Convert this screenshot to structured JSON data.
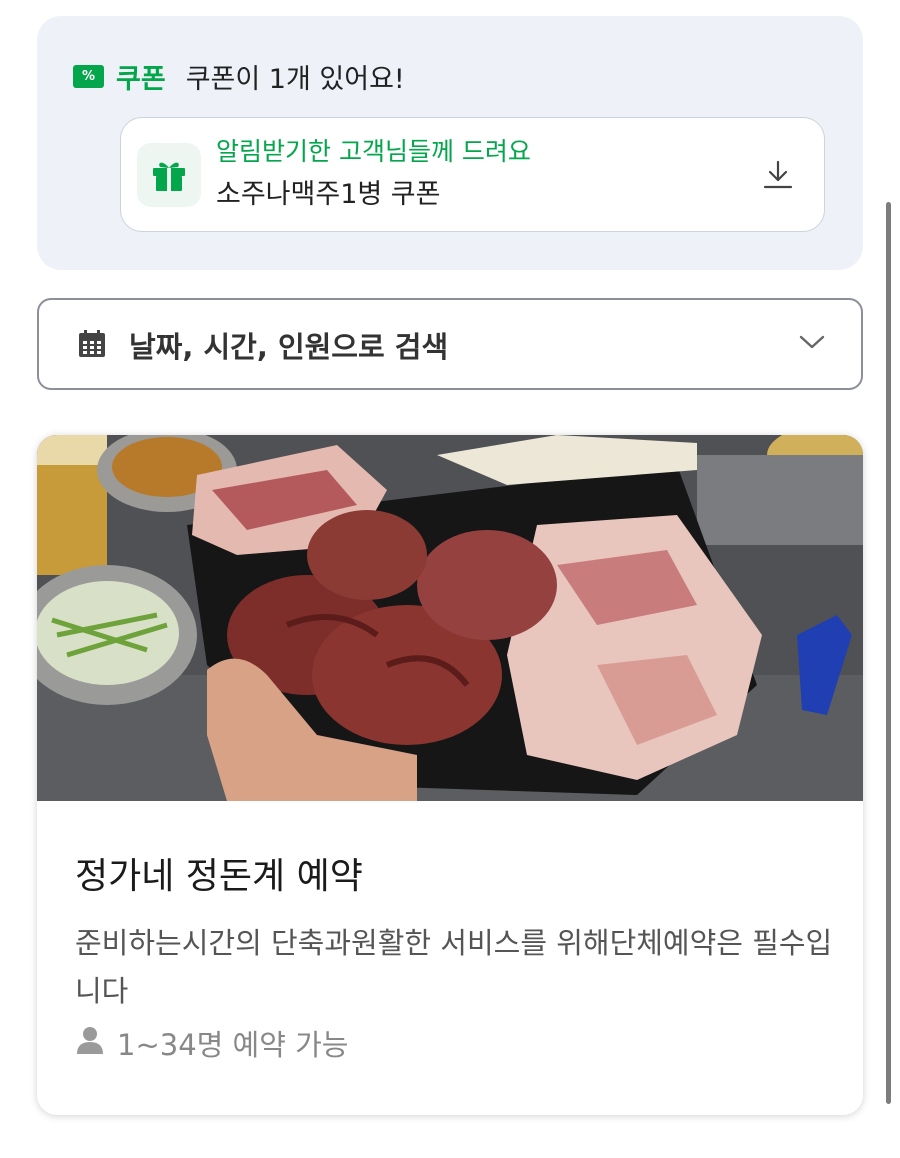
{
  "coupon": {
    "section_label": "쿠폰",
    "count_text": "쿠폰이 1개 있어요!",
    "tag_icon": "percent-coupon-icon",
    "item": {
      "subtitle": "알림받기한 고객님들께 드려요",
      "name": "소주나맥주1병 쿠폰",
      "icon": "gift-icon",
      "action_icon": "download-icon"
    }
  },
  "search": {
    "label": "날짜, 시간, 인원으로 검색",
    "icon": "calendar-icon",
    "toggle_icon": "chevron-down-icon"
  },
  "booking": {
    "image": "grilled-pork-platter-photo",
    "title": "정가네 정돈계 예약",
    "description": "준비하는시간의 단축과원활한 서비스를 위해단체예약은 필수입니다",
    "capacity": "1~34명 예약 가능",
    "capacity_icon": "person-icon"
  },
  "colors": {
    "accent_green": "#03a64a",
    "panel_bg": "#eef2f8",
    "border": "#cdd3dc"
  }
}
